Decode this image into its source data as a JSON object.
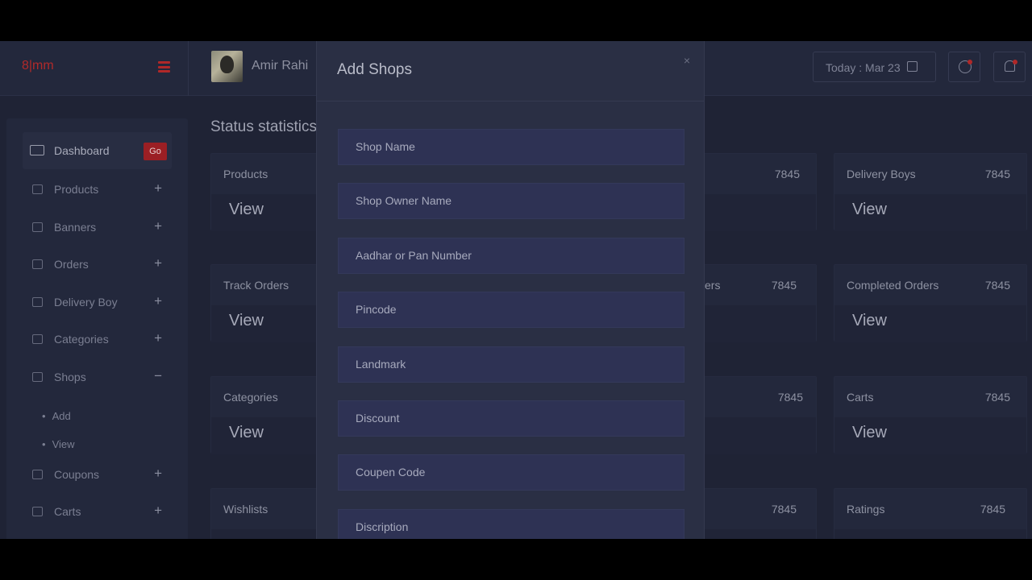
{
  "header": {
    "brand": "8|mm",
    "user_name": "Amir Rahi",
    "today": "Today : Mar 23"
  },
  "sidebar": {
    "items": [
      {
        "label": "Dashboard",
        "badge": "Go",
        "icon": "monitor-icon"
      },
      {
        "label": "Products",
        "toggle": "+",
        "icon": "pinterest-icon"
      },
      {
        "label": "Banners",
        "toggle": "+",
        "icon": "banner-icon"
      },
      {
        "label": "Orders",
        "toggle": "+",
        "icon": "briefcase-icon"
      },
      {
        "label": "Delivery Boy",
        "toggle": "+",
        "icon": "sitemap-icon"
      },
      {
        "label": "Categories",
        "toggle": "+",
        "icon": "tag-icon"
      },
      {
        "label": "Shops",
        "toggle": "−",
        "icon": "shop-icon"
      },
      {
        "label": "Coupons",
        "toggle": "+",
        "icon": "copy-icon"
      },
      {
        "label": "Carts",
        "toggle": "+",
        "icon": "cart-icon"
      }
    ],
    "shops_sub": [
      "Add",
      "View"
    ]
  },
  "main": {
    "title": "Status statistics",
    "view_label": "View",
    "cards": [
      {
        "title": "Products",
        "value": ""
      },
      {
        "title": "",
        "value": "7845"
      },
      {
        "title": "Delivery Boys",
        "value": "7845"
      },
      {
        "title": "Track Orders",
        "value": ""
      },
      {
        "title": "ers",
        "value": "7845"
      },
      {
        "title": "Completed Orders",
        "value": "7845"
      },
      {
        "title": "Categories",
        "value": ""
      },
      {
        "title": "",
        "value": "7845"
      },
      {
        "title": "Carts",
        "value": "7845"
      },
      {
        "title": "Wishlists",
        "value": ""
      },
      {
        "title": "",
        "value": "7845"
      },
      {
        "title": "Ratings",
        "value": "7845"
      }
    ]
  },
  "modal": {
    "title": "Add Shops",
    "close": "×",
    "fields": [
      "Shop Name",
      "Shop Owner Name",
      "Aadhar or Pan Number",
      "Pincode",
      "Landmark",
      "Discount",
      "Coupen Code",
      "Discription"
    ]
  }
}
